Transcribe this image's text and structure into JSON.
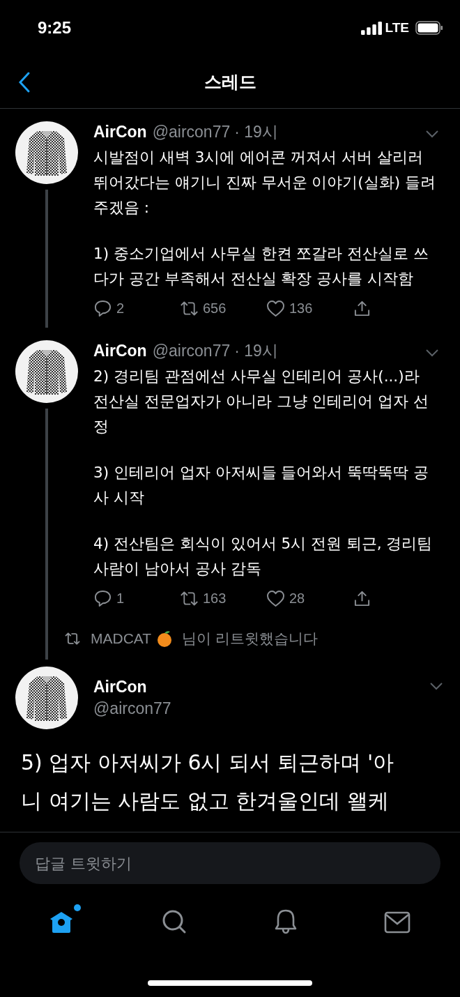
{
  "status_bar": {
    "time": "9:25",
    "network": "LTE"
  },
  "header": {
    "title": "스레드"
  },
  "thread": [
    {
      "kind": "tweet",
      "name": "AirCon",
      "handle": "@aircon77",
      "time": "· 19시",
      "thread_line": true,
      "paragraphs": [
        "시발점이 새벽 3시에 에어콘 꺼져서 서버 살리러 뛰어갔다는 얘기니 진짜 무서운 이야기(실화) 들려주겠음 :",
        "1) 중소기업에서 사무실 한켠 쪼갈라 전산실로 쓰다가 공간 부족해서 전산실 확장 공사를 시작함"
      ],
      "actions": [
        {
          "kind": "reply",
          "count": "2"
        },
        {
          "kind": "retweet",
          "count": "656"
        },
        {
          "kind": "like",
          "count": "136"
        },
        {
          "kind": "share"
        }
      ]
    },
    {
      "kind": "tweet",
      "name": "AirCon",
      "handle": "@aircon77",
      "time": "· 19시",
      "thread_line": true,
      "paragraphs": [
        "2) 경리팀 관점에선 사무실 인테리어 공사(...)라 전산실 전문업자가 아니라 그냥 인테리어 업자 선정",
        "3) 인테리어 업자 아저씨들 들어와서 뚝딱뚝딱 공사 시작",
        "4) 전산팀은 회식이 있어서 5시 전원 퇴근, 경리팀 사람이 남아서 공사 감독"
      ],
      "actions": [
        {
          "kind": "reply",
          "count": "1"
        },
        {
          "kind": "retweet",
          "count": "163"
        },
        {
          "kind": "like",
          "count": "28"
        },
        {
          "kind": "share"
        }
      ]
    },
    {
      "kind": "retweet_notice",
      "user": "MADCAT",
      "text": "님이 리트윗했습니다",
      "thread_line": true
    },
    {
      "kind": "main",
      "name": "AirCon",
      "handle": "@aircon77",
      "lines": [
        "5) 업자 아저씨가 6시 되서 퇴근하며 '아",
        "니 여기는 사람도 없고 한겨울인데 왤케"
      ]
    }
  ],
  "reply_field": {
    "placeholder": "답글 트윗하기"
  },
  "tab_bar": [
    {
      "kind": "home",
      "selected": true,
      "dot": true
    },
    {
      "kind": "search",
      "selected": false,
      "dot": false
    },
    {
      "kind": "notifications",
      "selected": false,
      "dot": false
    },
    {
      "kind": "messages",
      "selected": false,
      "dot": false
    }
  ]
}
